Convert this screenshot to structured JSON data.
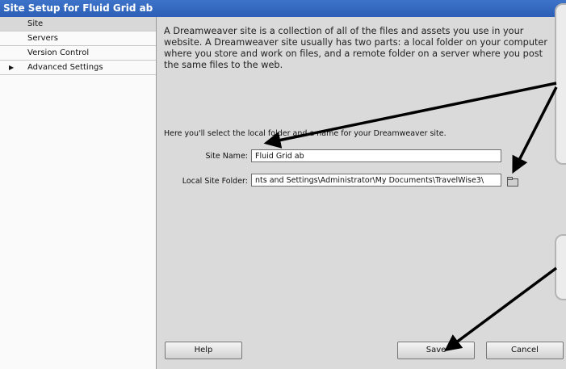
{
  "window": {
    "title": "Site Setup for Fluid Grid ab"
  },
  "sidebar": {
    "items": [
      {
        "label": "Site",
        "selected": true,
        "expandable": false
      },
      {
        "label": "Servers",
        "selected": false,
        "expandable": false
      },
      {
        "label": "Version Control",
        "selected": false,
        "expandable": false
      },
      {
        "label": "Advanced Settings",
        "selected": false,
        "expandable": true
      }
    ]
  },
  "main": {
    "intro": "A Dreamweaver site is a collection of all of the files and assets you use in your website. A Dreamweaver site usually has two parts: a local folder on your computer where you store and work on files, and a remote folder on a server where you post the same files to the web.",
    "subheading": "Here you'll select the local folder and a name for your Dreamweaver site.",
    "site_name": {
      "label": "Site Name:",
      "value": "Fluid Grid ab"
    },
    "local_folder": {
      "label": "Local Site Folder:",
      "value": "nts and Settings\\Administrator\\My Documents\\TravelWise3\\"
    }
  },
  "buttons": {
    "help": "Help",
    "save": "Save",
    "cancel": "Cancel"
  },
  "icons": {
    "folder": "folder-icon",
    "expand": "triangle-right-icon"
  },
  "colors": {
    "titlebar": "#2c5fb5",
    "dialog_bg": "#dadada",
    "sidebar_bg": "#fafafa",
    "sidebar_selected": "#d8d8d8",
    "arrow": "#000000"
  }
}
